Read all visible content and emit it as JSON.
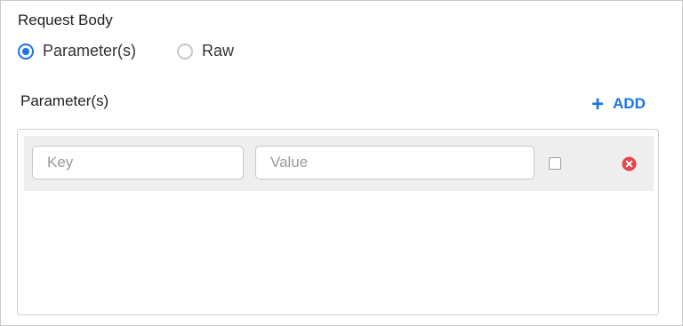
{
  "request_body": {
    "title": "Request Body",
    "options": [
      {
        "label": "Parameter(s)",
        "selected": true
      },
      {
        "label": "Raw",
        "selected": false
      }
    ]
  },
  "parameters": {
    "title": "Parameter(s)",
    "add_label": "ADD",
    "add_icon": "plus-icon",
    "rows": [
      {
        "key_placeholder": "Key",
        "value_placeholder": "Value",
        "key_value": "",
        "value_value": "",
        "checked": false,
        "remove_icon": "remove-circle-icon"
      }
    ]
  },
  "colors": {
    "accent": "#1a73e8",
    "remove": "#e0474c",
    "row_background": "#eeeeee"
  }
}
